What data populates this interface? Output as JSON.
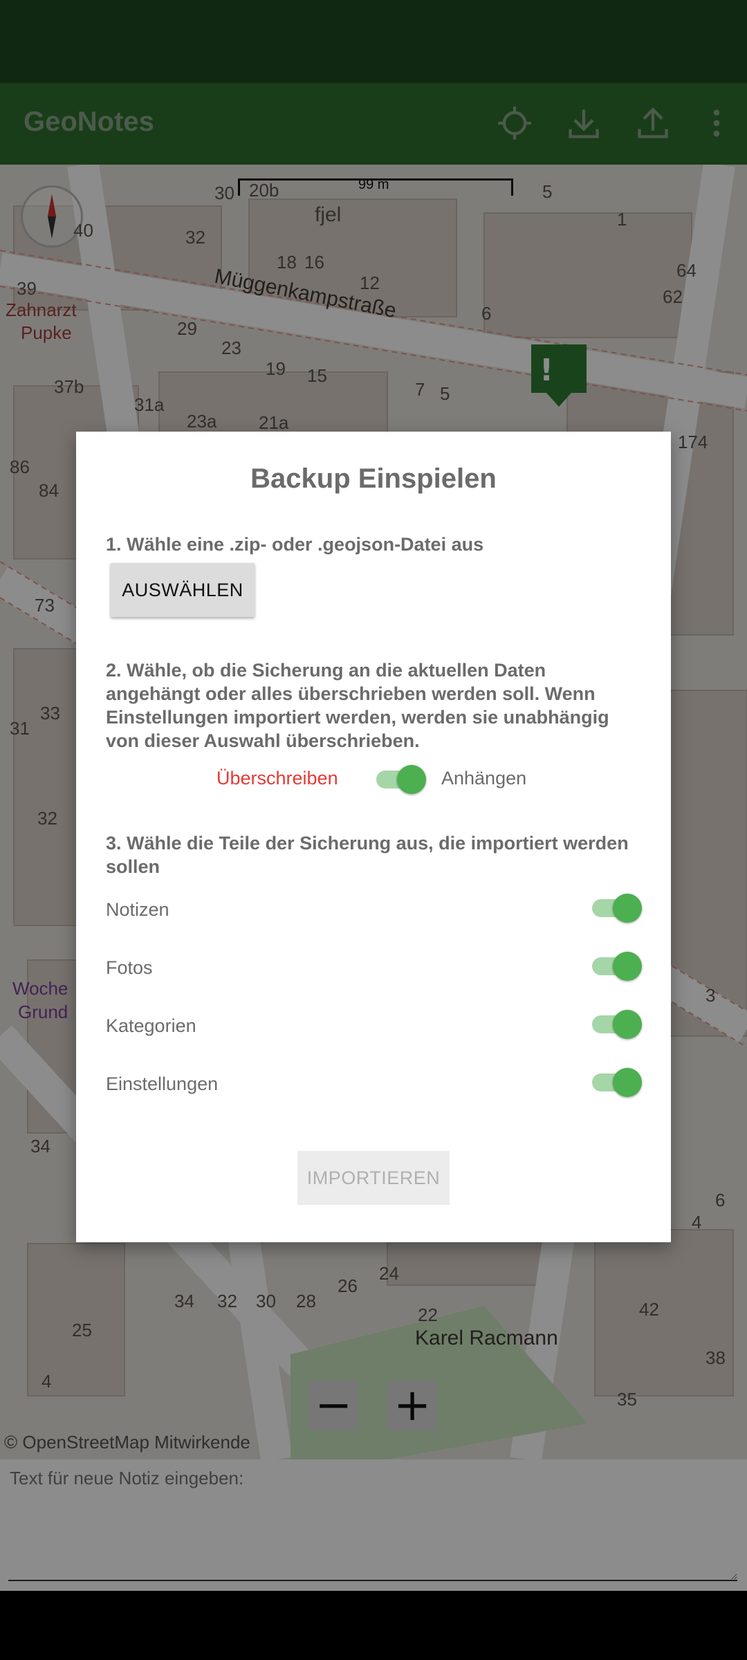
{
  "app": {
    "title": "GeoNotes",
    "actions": [
      "crosshair-icon",
      "download-icon",
      "upload-icon",
      "more-vert-icon"
    ]
  },
  "map": {
    "scale_label": "99 m",
    "street_names": [
      "Müggenkampstraße",
      "Karel Racmann"
    ],
    "attribution": "© OpenStreetMap Mitwirkende",
    "zoom_out": "−",
    "zoom_in": "+",
    "labels": [
      "Zahnarzt",
      "Pupke",
      "fjel",
      "20b",
      "30",
      "32",
      "18",
      "16",
      "12",
      "6",
      "29",
      "23",
      "19",
      "15",
      "7",
      "5",
      "37b",
      "31a",
      "23a",
      "21a",
      "39",
      "40",
      "86",
      "84",
      "73",
      "33",
      "31",
      "32",
      "34",
      "24",
      "26",
      "34",
      "32",
      "30",
      "28",
      "22",
      "25",
      "4",
      "42",
      "38",
      "35",
      "64",
      "62",
      "174",
      "5",
      "1",
      "3",
      "6",
      "4",
      "Woche",
      "Grund"
    ]
  },
  "note": {
    "placeholder": "Text für neue Notiz eingeben:"
  },
  "dialog": {
    "title": "Backup Einspielen",
    "step1": "1. Wähle eine .zip- oder .geojson-Datei aus",
    "choose_button": "AUSWÄHLEN",
    "step2": "2. Wähle, ob die Sicherung an die aktuellen Daten angehängt oder alles überschrieben werden soll. Wenn Einstellungen importiert werden, werden sie unabhängig von dieser Auswahl überschrieben.",
    "mode_overwrite": "Überschreiben",
    "mode_append": "Anhängen",
    "mode_append_on": true,
    "step3": "3. Wähle die Teile der Sicherung aus, die importiert werden sollen",
    "options": [
      {
        "label": "Notizen",
        "on": true
      },
      {
        "label": "Fotos",
        "on": true
      },
      {
        "label": "Kategorien",
        "on": true
      },
      {
        "label": "Einstellungen",
        "on": true
      }
    ],
    "import_button": "IMPORTIEREN"
  },
  "colors": {
    "app_bar": "#2f6f2c",
    "status_bar": "#1e4a1f",
    "switch_on": "#4caf50",
    "overwrite_text": "#e53935"
  }
}
